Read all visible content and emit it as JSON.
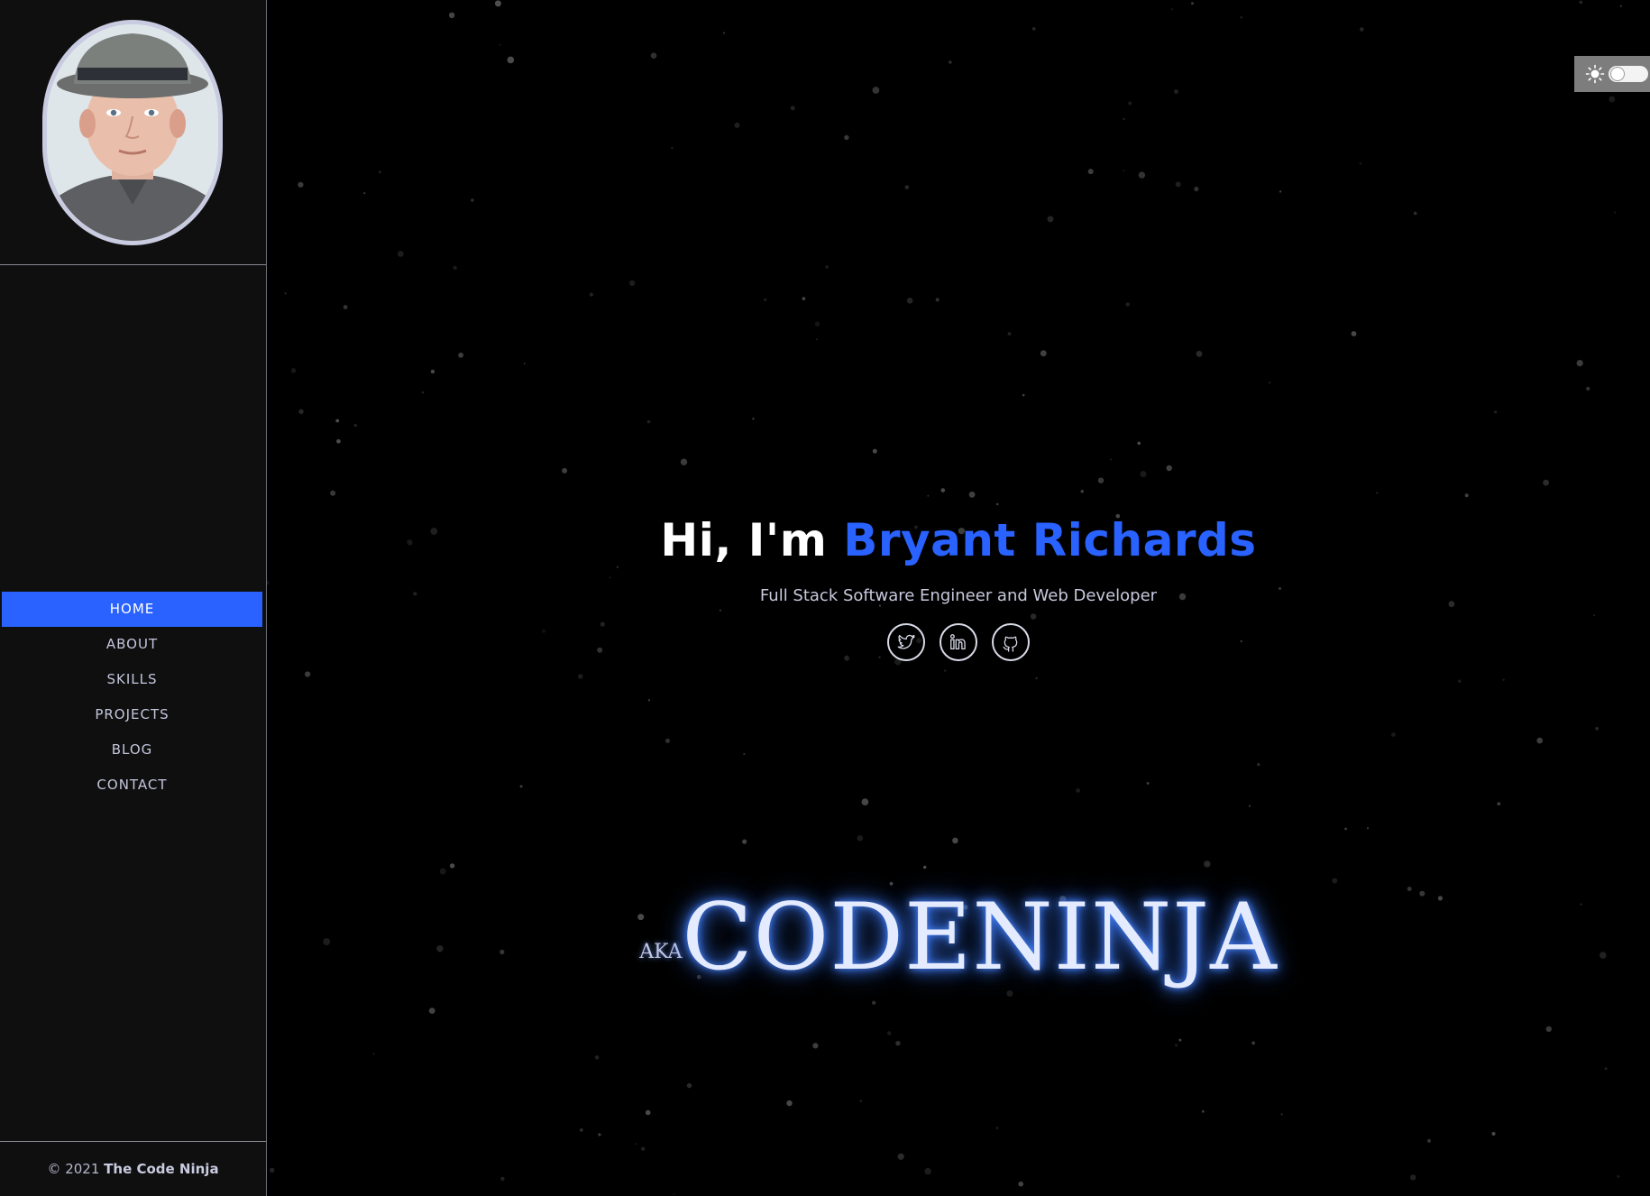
{
  "sidebar": {
    "avatar_alt": "Profile photo",
    "nav": [
      {
        "label": "HOME",
        "active": true
      },
      {
        "label": "ABOUT",
        "active": false
      },
      {
        "label": "SKILLS",
        "active": false
      },
      {
        "label": "PROJECTS",
        "active": false
      },
      {
        "label": "BLOG",
        "active": false
      },
      {
        "label": "CONTACT",
        "active": false
      }
    ],
    "footer": {
      "copyright": "© 2021",
      "owner": "The Code Ninja"
    }
  },
  "theme_toggle": {
    "icon": "sun-icon",
    "state": "off"
  },
  "hero": {
    "greeting_prefix": "Hi, I'm",
    "name": "Bryant Richards",
    "subtitle": "Full Stack Software Engineer and Web Developer",
    "socials": [
      {
        "icon": "twitter-icon"
      },
      {
        "icon": "linkedin-icon"
      },
      {
        "icon": "github-icon"
      }
    ]
  },
  "alias": {
    "prefix": "AKA",
    "name": "CODENINJA"
  },
  "colors": {
    "accent": "#2962ff",
    "sidebar_bg": "#0f0f10",
    "main_bg": "#000000",
    "glow": "#3c7bff"
  }
}
